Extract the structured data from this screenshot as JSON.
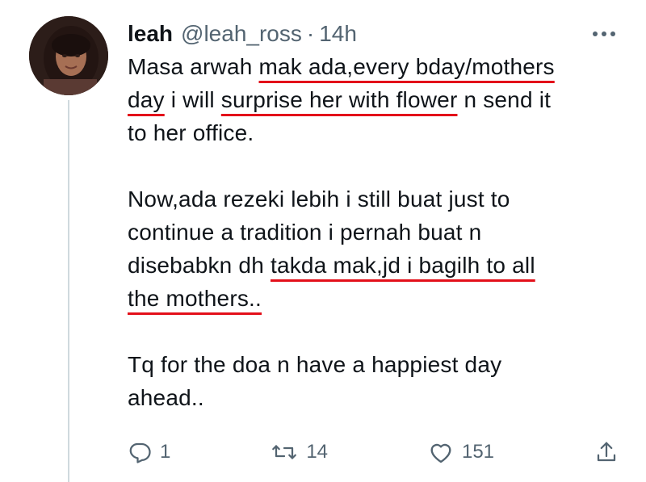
{
  "tweet": {
    "author": {
      "name": "leah",
      "handle": "@leah_ross",
      "separator": "·",
      "time": "14h"
    },
    "more_icon": "more-horizontal-icon",
    "lines": [
      {
        "segments": [
          {
            "text": "Masa arwah "
          },
          {
            "text": "mak ada,every bday/mothers",
            "underline": true
          }
        ]
      },
      {
        "segments": [
          {
            "text": "day",
            "underline": true
          },
          {
            "text": " i will "
          },
          {
            "text": "surprise her with flower",
            "underline": true
          },
          {
            "text": " n send it"
          }
        ]
      },
      {
        "segments": [
          {
            "text": "to her office."
          }
        ]
      },
      {
        "segments": []
      },
      {
        "segments": [
          {
            "text": "Now,ada rezeki lebih i still buat just to"
          }
        ]
      },
      {
        "segments": [
          {
            "text": "continue a tradition i pernah buat n"
          }
        ]
      },
      {
        "segments": [
          {
            "text": "disebabkn dh "
          },
          {
            "text": "takda mak,jd i bagilh to all",
            "underline": true
          }
        ]
      },
      {
        "segments": [
          {
            "text": "the mothers..",
            "underline": true
          }
        ]
      },
      {
        "segments": []
      },
      {
        "segments": [
          {
            "text": "Tq for the doa n have a happiest day"
          }
        ]
      },
      {
        "segments": [
          {
            "text": "ahead.."
          }
        ]
      }
    ],
    "annotation_color": "#e3101a",
    "actions": {
      "reply": {
        "icon": "reply-icon",
        "count": "1"
      },
      "retweet": {
        "icon": "retweet-icon",
        "count": "14"
      },
      "like": {
        "icon": "heart-icon",
        "count": "151"
      },
      "share": {
        "icon": "share-icon"
      }
    }
  }
}
